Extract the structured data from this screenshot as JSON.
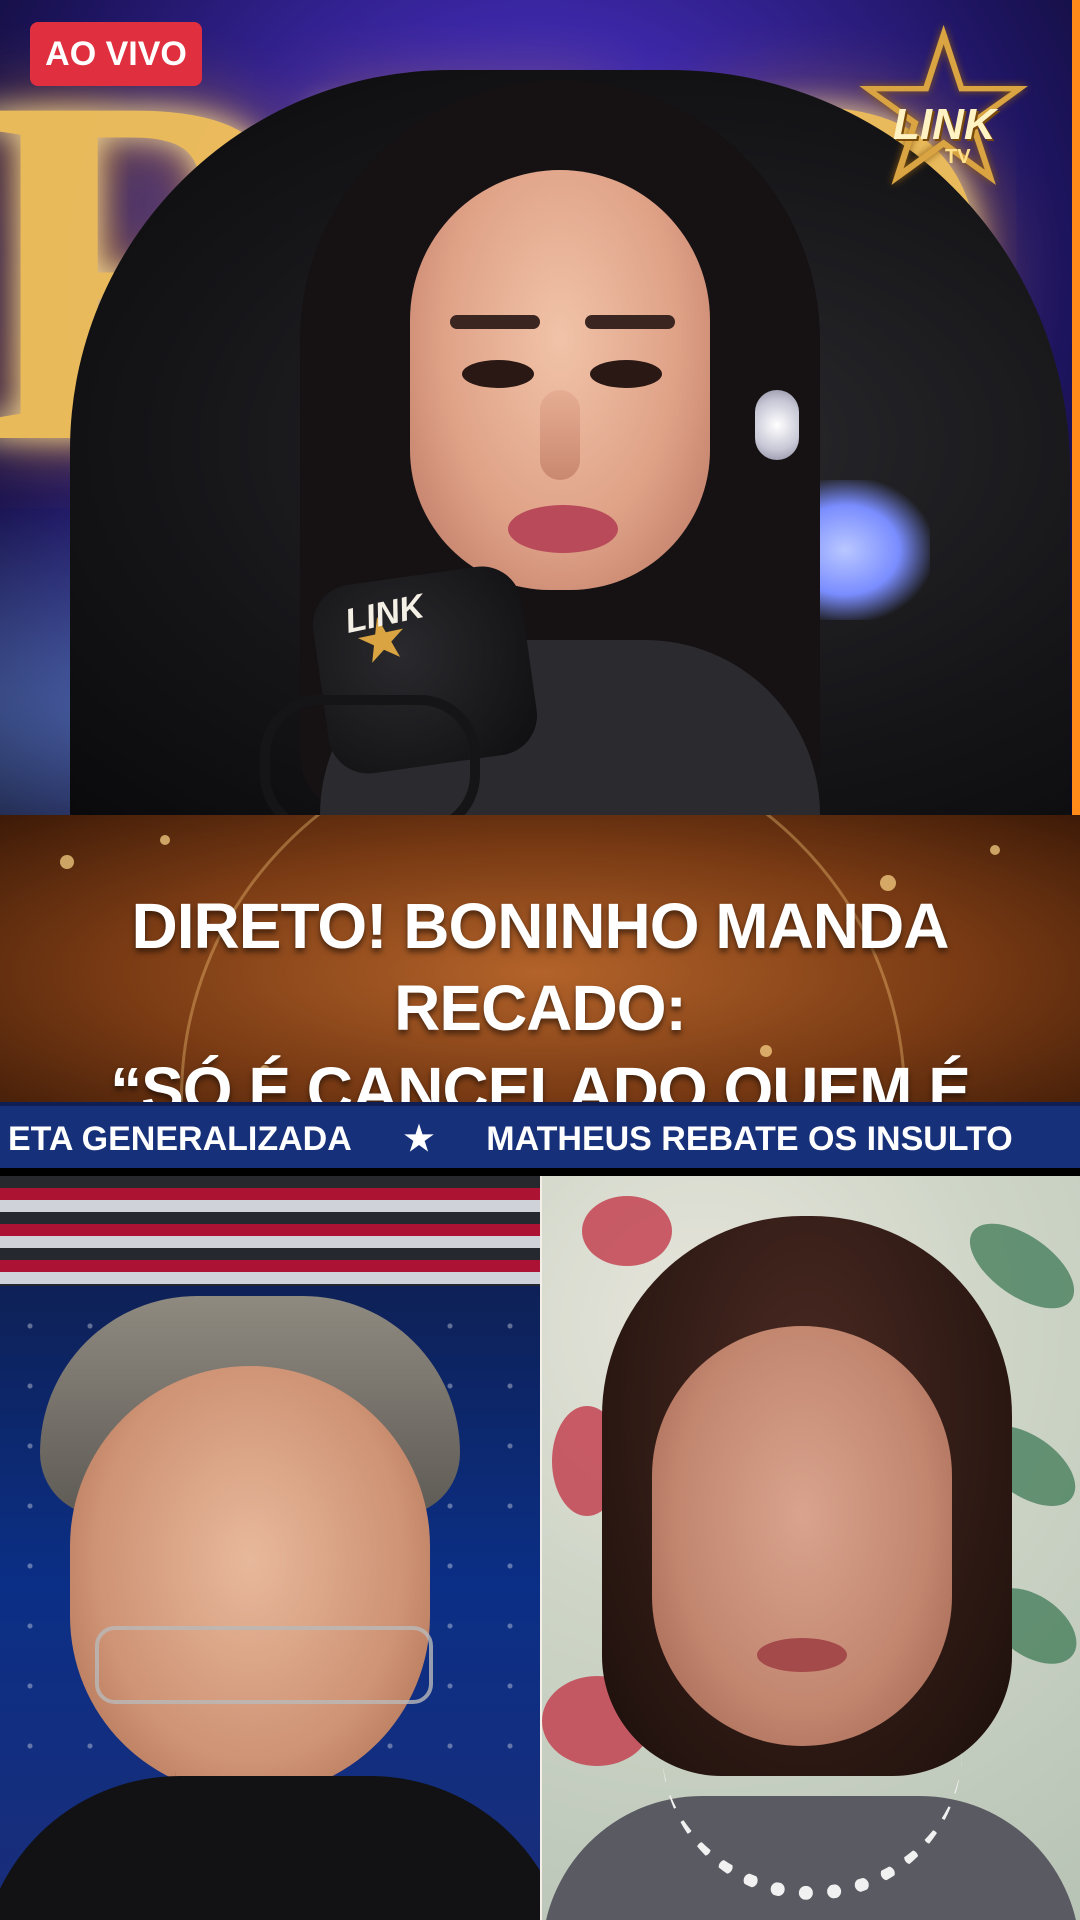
{
  "live": {
    "label": "AO VIVO"
  },
  "brand": {
    "name": "LINK",
    "sub": "TV"
  },
  "mic": {
    "logo": "LINK"
  },
  "headline": {
    "line1": "DIRETO! BONINHO MANDA RECADO:",
    "line2": "“SÓ É CANCELADO QUEM É CONHECIDO”"
  },
  "ticker": {
    "items": [
      "ETA GENERALIZADA",
      "★",
      "MATHEUS REBATE OS INSULTO"
    ]
  },
  "colors": {
    "live_badge": "#e0303f",
    "ticker_bg": "#17307a",
    "headline_bg": "#7a3b14",
    "accent_orange": "#ff8a1a"
  }
}
